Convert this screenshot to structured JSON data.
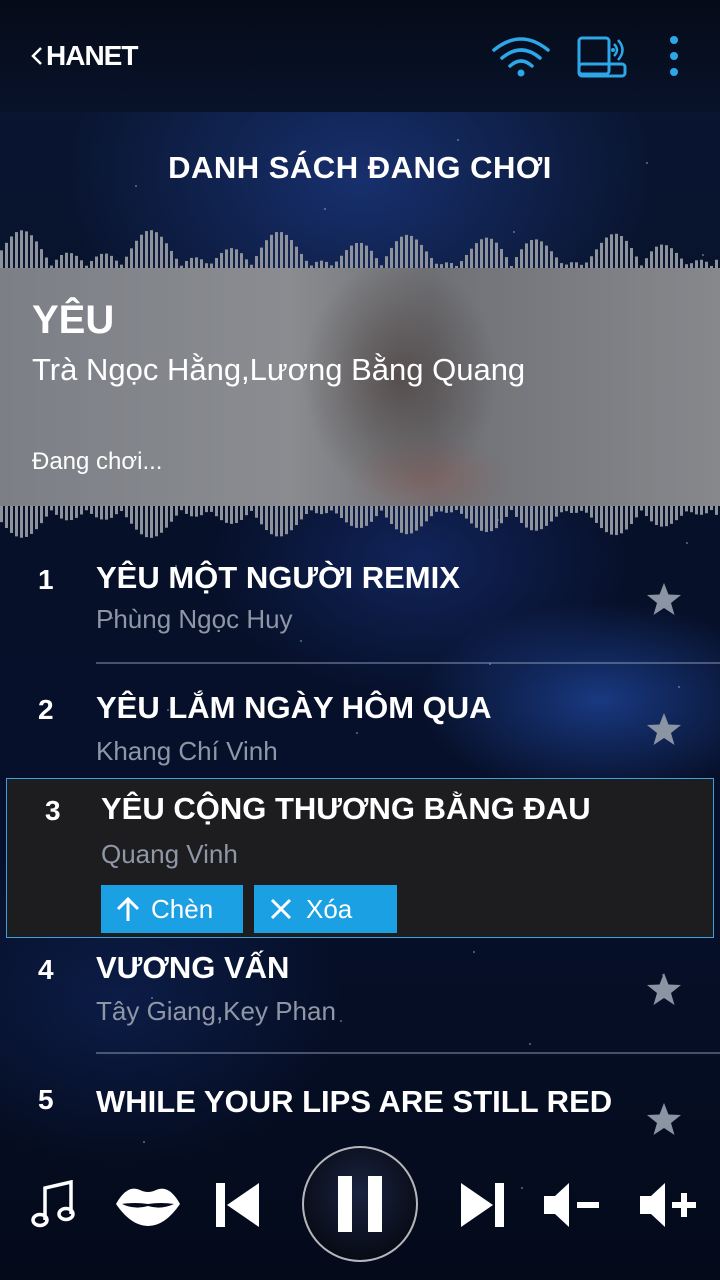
{
  "header": {
    "logo_text": "HANET",
    "icons": [
      "back-chevron-icon",
      "wifi-icon",
      "router-device-icon",
      "more-vertical-icon"
    ]
  },
  "page": {
    "title": "DANH SÁCH ĐANG CHƠI"
  },
  "now_playing": {
    "title": "YÊU",
    "artist": "Trà Ngọc Hằng,Lương Bằng Quang",
    "status": "Đang chơi..."
  },
  "playlist": [
    {
      "number": "1",
      "title": "YÊU MỘT NGƯỜI REMIX",
      "artist": "Phùng Ngọc Huy"
    },
    {
      "number": "2",
      "title": "YÊU LẮM NGÀY HÔM QUA",
      "artist": "Khang Chí Vinh"
    },
    {
      "number": "3",
      "title": "YÊU CỘNG THƯƠNG BẰNG ĐAU",
      "artist": "Quang Vinh"
    },
    {
      "number": "4",
      "title": "VƯƠNG VẤN",
      "artist": "Tây Giang,Key Phan"
    },
    {
      "number": "5",
      "title": "WHILE YOUR LIPS ARE STILL RED",
      "artist": ""
    }
  ],
  "selected_actions": {
    "insert_label": "Chèn",
    "delete_label": "Xóa"
  },
  "controls": {
    "icons": [
      "music-note-icon",
      "lips-icon",
      "skip-previous-icon",
      "pause-icon",
      "skip-next-icon",
      "volume-down-icon",
      "volume-up-icon"
    ]
  },
  "colors": {
    "accent": "#1aa0e3",
    "selected_border": "#3fa0e0",
    "artist_text": "#8f97a6",
    "background": "#06102a"
  }
}
